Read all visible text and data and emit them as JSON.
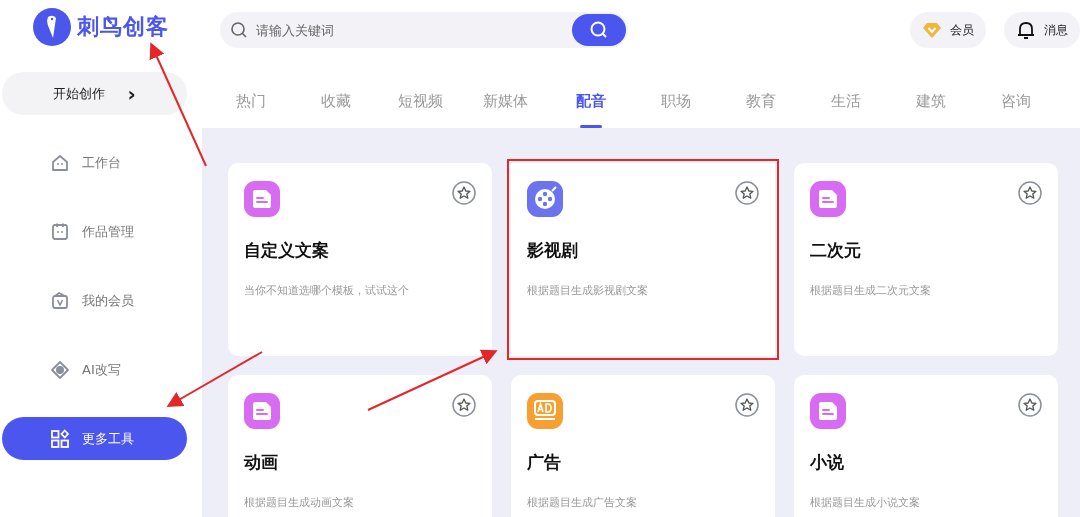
{
  "brand": {
    "name": "刺鸟创客"
  },
  "sidebar": {
    "start_button": {
      "label": "开始创作",
      "icon": "›"
    },
    "items": [
      {
        "label": "工作台",
        "kind": "home",
        "selected": false
      },
      {
        "label": "作品管理",
        "kind": "calendar",
        "selected": false
      },
      {
        "label": "我的会员",
        "kind": "vip",
        "selected": false
      },
      {
        "label": "AI改写",
        "kind": "ai",
        "selected": false
      },
      {
        "label": "更多工具",
        "kind": "grid",
        "selected": true
      }
    ]
  },
  "search": {
    "placeholder": "请输入关键词"
  },
  "header_buttons": [
    {
      "label": "会员",
      "kind": "vip"
    },
    {
      "label": "消息",
      "kind": "bell"
    }
  ],
  "tabs": [
    {
      "label": "热门",
      "selected": false
    },
    {
      "label": "收藏",
      "selected": false
    },
    {
      "label": "短视频",
      "selected": false
    },
    {
      "label": "新媒体",
      "selected": false
    },
    {
      "label": "配音",
      "selected": true
    },
    {
      "label": "职场",
      "selected": false
    },
    {
      "label": "教育",
      "selected": false
    },
    {
      "label": "生活",
      "selected": false
    },
    {
      "label": "建筑",
      "selected": false
    },
    {
      "label": "咨询",
      "selected": false
    }
  ],
  "cards": [
    {
      "kind": "doc",
      "title": "自定义文案",
      "description": "当你不知道选哪个模板，试试这个",
      "highlighted": false
    },
    {
      "kind": "film",
      "title": "影视剧",
      "description": "根据题目生成影视剧文案",
      "highlighted": true
    },
    {
      "kind": "doc",
      "title": "二次元",
      "description": "根据题目生成二次元文案",
      "highlighted": false
    },
    {
      "kind": "doc",
      "title": "动画",
      "description": "根据题目生成动画文案",
      "highlighted": false
    },
    {
      "kind": "ad",
      "title": "广告",
      "description": "根据题目生成广告文案",
      "highlighted": false
    },
    {
      "kind": "doc",
      "title": "小说",
      "description": "根据题目生成小说文案",
      "highlighted": false
    }
  ]
}
